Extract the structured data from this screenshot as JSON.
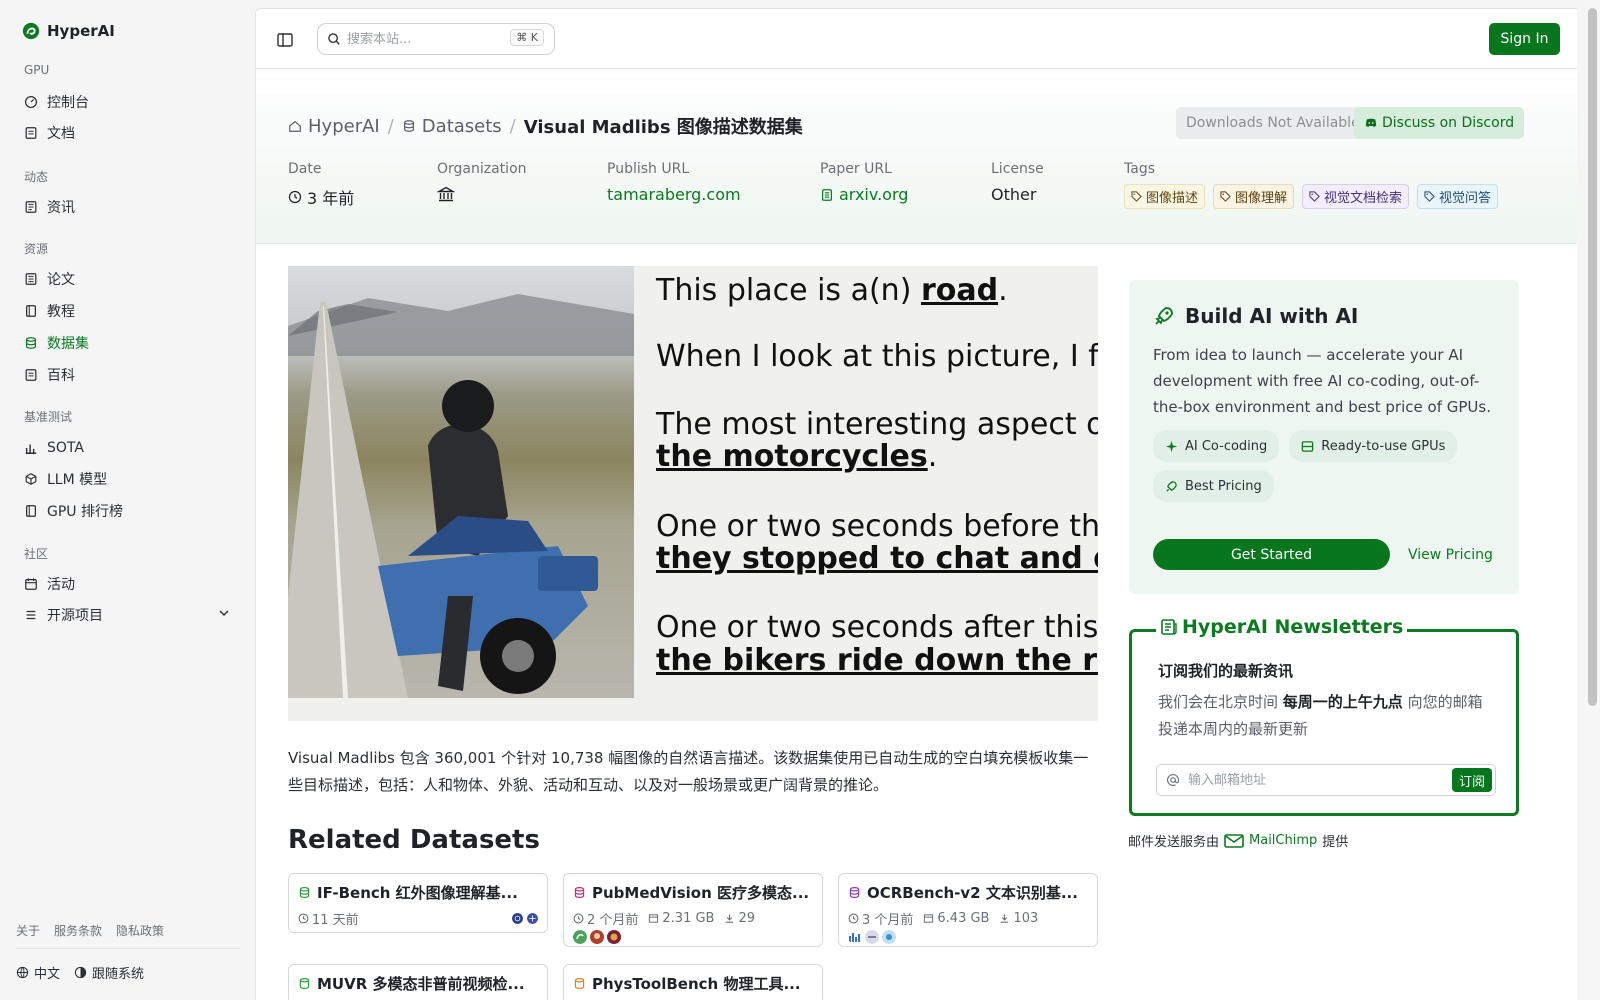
{
  "brand": {
    "name": "HyperAI"
  },
  "sidebar": {
    "sections": [
      {
        "label": "GPU"
      },
      {
        "label": "动态"
      },
      {
        "label": "资源"
      },
      {
        "label": "基准测试"
      },
      {
        "label": "社区"
      }
    ],
    "items": [
      {
        "label": "控制台",
        "icon": "dashboard-icon"
      },
      {
        "label": "文档",
        "icon": "doc-icon"
      },
      {
        "label": "资讯",
        "icon": "news-icon"
      },
      {
        "label": "论文",
        "icon": "paper-icon"
      },
      {
        "label": "教程",
        "icon": "book-icon"
      },
      {
        "label": "数据集",
        "icon": "database-icon",
        "active": true
      },
      {
        "label": "百科",
        "icon": "wiki-icon"
      },
      {
        "label": "SOTA",
        "icon": "chart-icon"
      },
      {
        "label": "LLM 模型",
        "icon": "cube-icon"
      },
      {
        "label": "GPU 排行榜",
        "icon": "ranking-icon"
      },
      {
        "label": "活动",
        "icon": "calendar-icon"
      },
      {
        "label": "开源项目",
        "icon": "list-icon"
      }
    ],
    "footer_links": [
      "关于",
      "服务条款",
      "隐私政策"
    ],
    "language": "中文",
    "theme": "跟随系统"
  },
  "topbar": {
    "search_placeholder": "搜索本站...",
    "shortcut": "⌘ K",
    "signin": "Sign In"
  },
  "breadcrumb": {
    "home": "HyperAI",
    "section": "Datasets",
    "current": "Visual Madlibs 图像描述数据集"
  },
  "actions": {
    "downloads": "Downloads Not Available",
    "discord": "Discuss on Discord"
  },
  "meta": {
    "date_label": "Date",
    "date_value": "3 年前",
    "org_label": "Organization",
    "publish_label": "Publish URL",
    "publish_value": "tamaraberg.com",
    "paper_label": "Paper URL",
    "paper_value": "arxiv.org",
    "license_label": "License",
    "license_value": "Other",
    "tags_label": "Tags",
    "tags": [
      "图像描述",
      "图像理解",
      "视觉文档检索",
      "视觉问答"
    ]
  },
  "hero": {
    "lines": [
      {
        "pre": "This place is a(n) ",
        "bold": "road",
        "post": "."
      },
      {
        "pre": "When I look at this picture, I fee",
        "bold": "",
        "post": ""
      },
      {
        "pre": "The most interesting aspect of",
        "bold": "",
        "post": ""
      },
      {
        "pre": "",
        "bold": "the motorcycles",
        "post": "."
      },
      {
        "pre": "One or two seconds before this",
        "bold": "",
        "post": ""
      },
      {
        "pre": "",
        "bold": "they stopped to chat and dec",
        "post": ""
      },
      {
        "pre": "One or two seconds after this p",
        "bold": "",
        "post": ""
      },
      {
        "pre": "",
        "bold": "the bikers ride down the road",
        "post": ""
      }
    ]
  },
  "description": "Visual Madlibs 包含 360,001 个针对 10,738 幅图像的自然语言描述。该数据集使用已自动生成的空白填充模板收集一些目标描述，包括：人和物体、外貌、活动和互动、以及对一般场景或更广阔背景的推论。",
  "related": {
    "title": "Related Datasets",
    "cards": [
      {
        "title": "IF-Bench 红外图像理解基...",
        "time": "11 天前",
        "size": "",
        "downloads": ""
      },
      {
        "title": "PubMedVision 医疗多模态...",
        "time": "2 个月前",
        "size": "2.31 GB",
        "downloads": "29"
      },
      {
        "title": "OCRBench-v2 文本识别基...",
        "time": "3 个月前",
        "size": "6.43 GB",
        "downloads": "103"
      },
      {
        "title": "MUVR 多模态非普前视频检...",
        "time": "",
        "size": "",
        "downloads": ""
      },
      {
        "title": "PhysToolBench 物理工具...",
        "time": "",
        "size": "",
        "downloads": ""
      }
    ]
  },
  "promo": {
    "title": "Build AI with AI",
    "desc": "From idea to launch — accelerate your AI development with free AI co-coding, out-of-the-box environment and best price of GPUs.",
    "chips": [
      "AI Co-coding",
      "Ready-to-use GPUs",
      "Best Pricing"
    ],
    "cta": "Get Started",
    "pricing": "View Pricing"
  },
  "newsletter": {
    "legend": "HyperAI Newsletters",
    "title": "订阅我们的最新资讯",
    "desc_pre": "我们会在北京时间 ",
    "desc_bold": "每周一的上午九点",
    "desc_post": " 向您的邮箱投递本周内的最新更新",
    "placeholder": "输入邮箱地址",
    "submit": "订阅",
    "service_pre": "邮件发送服务由",
    "service_name": "MailChimp",
    "service_post": "提供"
  },
  "colors": {
    "accent": "#07761c",
    "link": "#0b7a20"
  }
}
